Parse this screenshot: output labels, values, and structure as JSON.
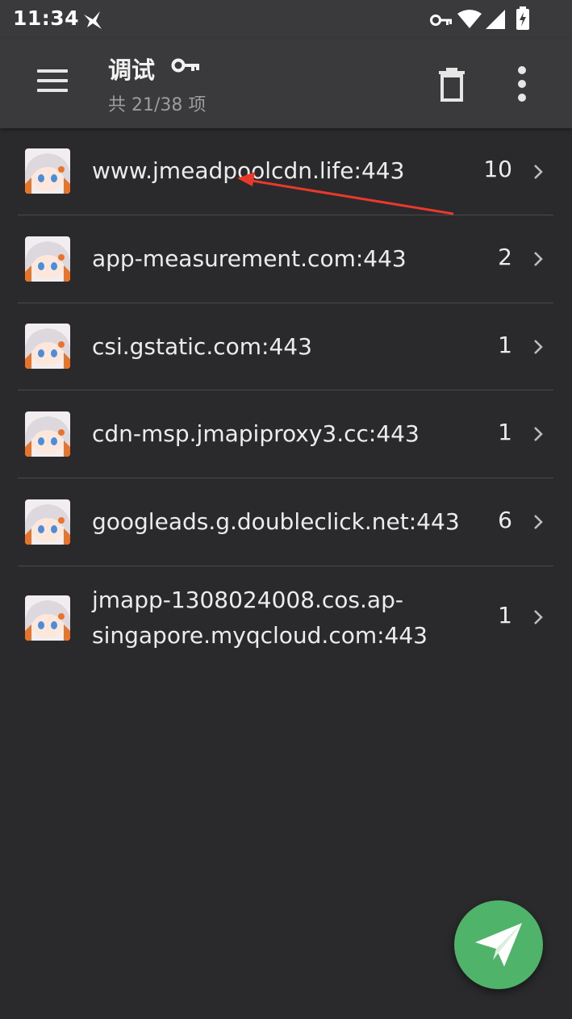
{
  "statusbar": {
    "time": "11:34"
  },
  "header": {
    "title": "调试",
    "subtitle": "共 21/38 项"
  },
  "colors": {
    "background": "#2a292c",
    "toolbar": "#3a393c",
    "fab": "#4fb36a",
    "annotation_arrow": "#e8392b"
  },
  "hosts": [
    {
      "host": "www.jmeadpoolcdn.life:443",
      "count": "10"
    },
    {
      "host": "app-measurement.com:443",
      "count": "2"
    },
    {
      "host": "csi.gstatic.com:443",
      "count": "1"
    },
    {
      "host": "cdn-msp.jmapiproxy3.cc:443",
      "count": "1"
    },
    {
      "host": "googleads.g.doubleclick.net:443",
      "count": "6"
    },
    {
      "host_line1": "jmapp-1308024008.cos.ap-",
      "host_line2": "singapore.myqcloud.com:443",
      "count": "1"
    }
  ],
  "icons": {
    "menu": "hamburger-menu-icon",
    "title_badge": "key-icon",
    "delete": "trash-icon",
    "more": "more-vertical-icon",
    "row_avatar": "anime-avatar-icon",
    "row_arrow": "chevron-right-icon",
    "fab": "send-icon"
  }
}
